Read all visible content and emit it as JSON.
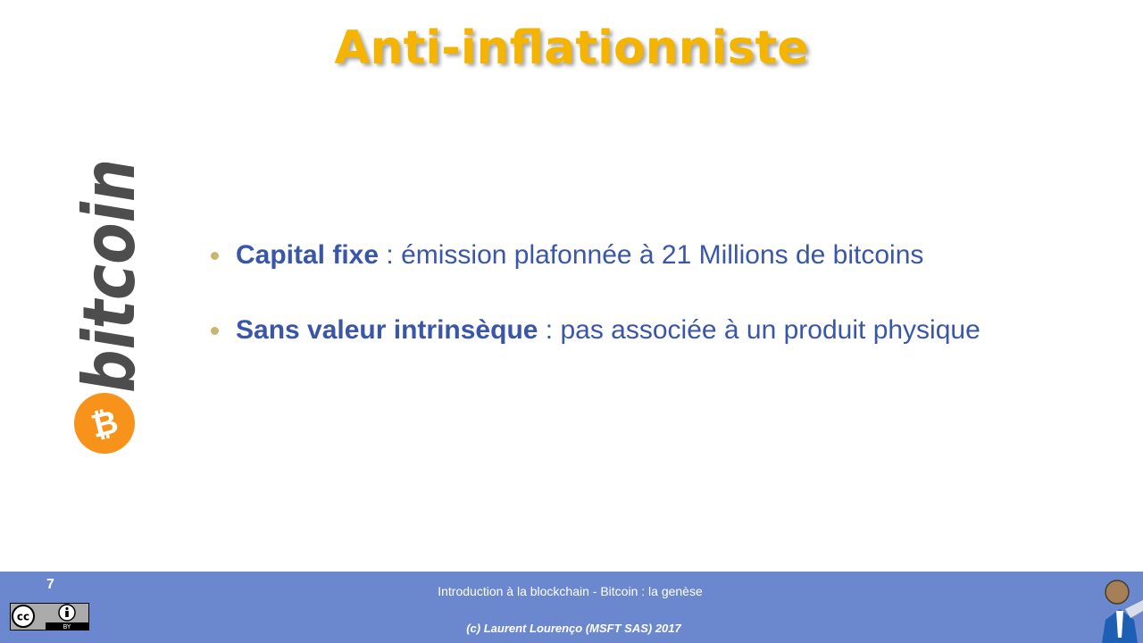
{
  "slide": {
    "title": "Anti-inflationniste",
    "logo_text": "bitcoin",
    "bullets": [
      {
        "bold": "Capital fixe",
        "rest": " : émission plafonnée à 21 Millions de bitcoins"
      },
      {
        "bold": "Sans valeur intrinsèque",
        "rest": " : pas associée à un produit physique"
      }
    ]
  },
  "footer": {
    "page_number": "7",
    "title": "Introduction  à la blockchain - Bitcoin : la genèse",
    "copyright": "(c) Laurent Lourenço (MSFT SAS) 2017",
    "license_badge_text": "BY"
  },
  "colors": {
    "title": "#f5b400",
    "bullet_text": "#3956a8",
    "footer_bg": "#6b88cf",
    "bitcoin_orange": "#f7931a",
    "bitcoin_text": "#4d4d4d"
  }
}
